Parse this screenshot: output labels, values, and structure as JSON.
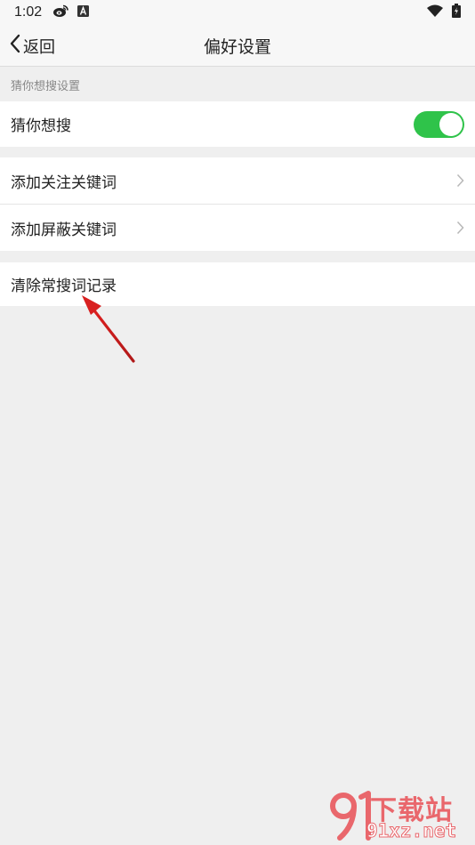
{
  "status_bar": {
    "time": "1:02",
    "icons_left": [
      "weibo-icon",
      "a-badge-icon"
    ],
    "icons_right": [
      "wifi-icon",
      "battery-icon"
    ]
  },
  "nav": {
    "back_label": "返回",
    "title": "偏好设置"
  },
  "sections": {
    "guess_header": "猜你想搜设置",
    "guess_toggle": {
      "label": "猜你想搜",
      "enabled": true
    },
    "add_follow": "添加关注关键词",
    "add_block": "添加屏蔽关键词",
    "clear_history": "清除常搜词记录"
  },
  "watermark": {
    "top": "下载站",
    "bottom": "91xz.net"
  },
  "colors": {
    "toggle_on": "#2fc34a",
    "background": "#efefef",
    "arrow": "#d32020",
    "watermark": "#e9676c"
  }
}
